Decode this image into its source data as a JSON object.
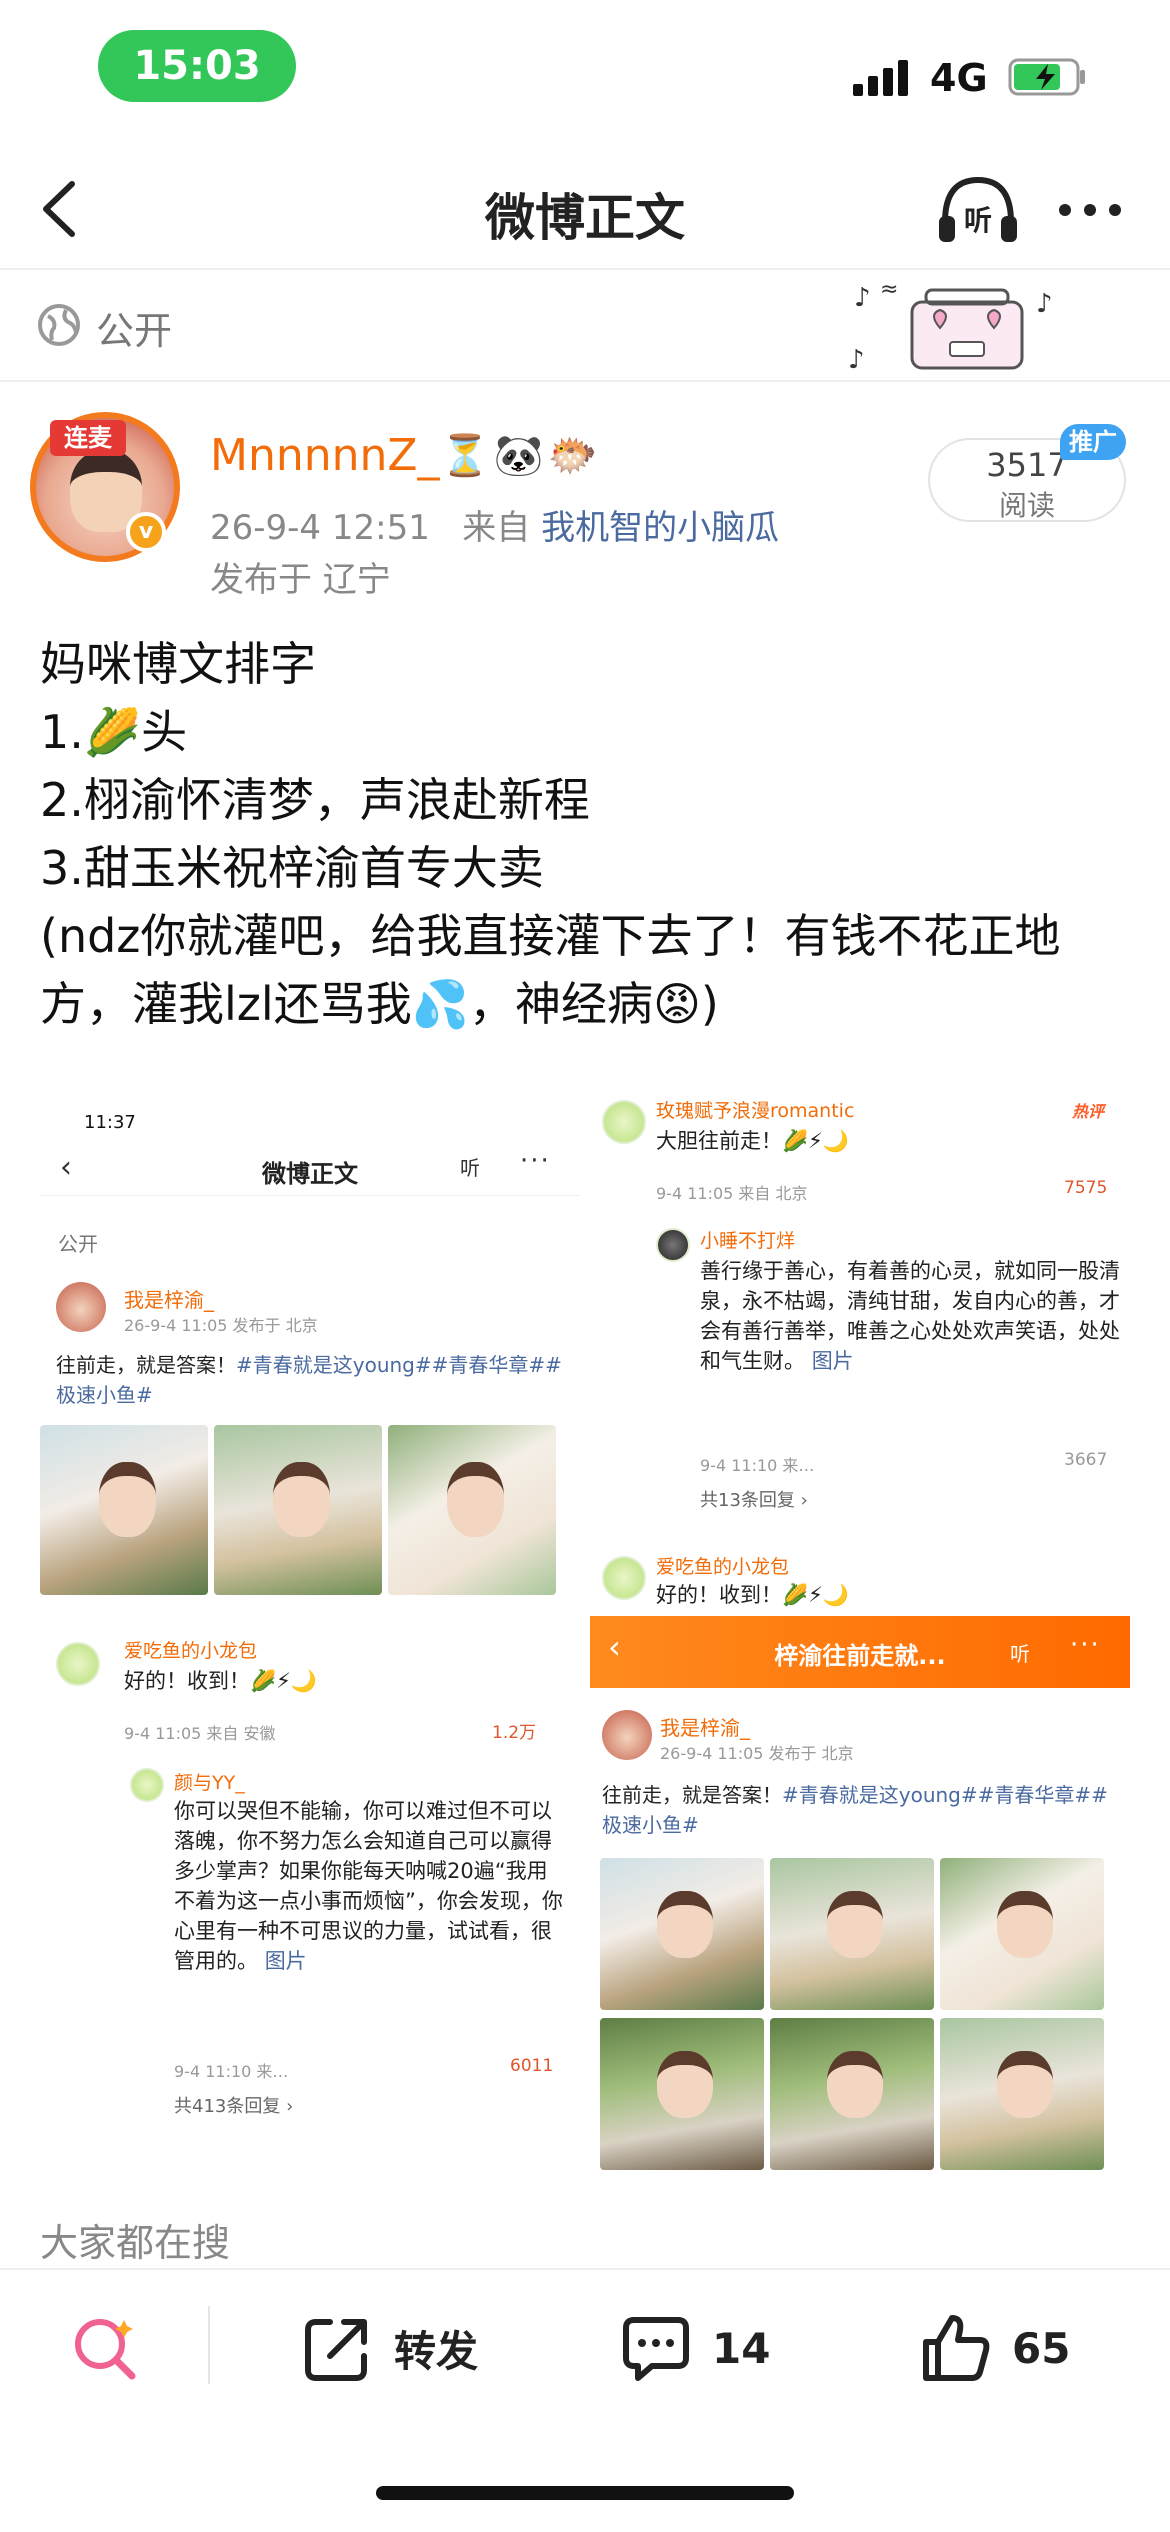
{
  "status_bar": {
    "time": "15:03",
    "network": "4G"
  },
  "nav": {
    "title": "微博正文",
    "listen_label": "听"
  },
  "visibility": {
    "label": "公开"
  },
  "author": {
    "avatar_tag": "连麦",
    "name": "MnnnnnZ_",
    "name_emojis": [
      "⏳",
      "🐼",
      "🐡"
    ],
    "timestamp": "26-9-4 12:51",
    "source_prefix": "来自",
    "source": "我机智的小脑瓜",
    "location": "发布于 辽宁"
  },
  "read_counter": {
    "count": "3517",
    "label": "阅读",
    "promo": "推广"
  },
  "post_lines": [
    "妈咪博文排字",
    "1.🌽头",
    "2.栩渝怀清梦，声浪赴新程",
    "3.甜玉米祝梓渝首专大卖",
    "(ndz你就灌吧，给我直接灌下去了！有钱不花正地方，灌我lzl还骂我💦，神经病😡)"
  ],
  "embedded": {
    "left": {
      "status_time": "11:37",
      "nav_title": "微博正文",
      "nav_listen": "听",
      "visibility": "公开",
      "post_author": "我是梓渝_",
      "post_meta": "26-9-4 11:05  发布于 北京",
      "post_text": "往前走，就是答案！",
      "post_tags": "#青春就是这young##青春华章##极速小鱼#",
      "comment1": {
        "name": "爱吃鱼的小龙包",
        "text": "好的！收到！🌽⚡🌙",
        "meta": "9-4 11:05 来自 安徽",
        "likes": "1.2万"
      },
      "reply1": {
        "name": "颜与YY_",
        "text": "你可以哭但不能输，你可以难过但不可以落魄，你不努力怎么会知道自己可以赢得多少掌声？如果你能每天呐喊20遍“我用不着为这一点小事而烦恼”，你会发现，你心里有一种不可思议的力量，试试看，很管用的。",
        "image_link": "图片",
        "meta": "9-4 11:10 来…",
        "likes": "6011"
      },
      "more_replies": "共413条回复 ›"
    },
    "right": {
      "comment1": {
        "name": "玫瑰赋予浪漫romantic",
        "hot": "热评",
        "text": "大胆往前走！🌽⚡🌙",
        "meta": "9-4 11:05 来自 北京",
        "likes": "7575"
      },
      "reply1": {
        "name": "小睡不打烊",
        "text": "善行缘于善心，有着善的心灵，就如同一股清泉，永不枯竭，清纯甘甜，发自内心的善，才会有善行善举，唯善之心处处欢声笑语，处处和气生财。",
        "image_link": "图片",
        "meta": "9-4 11:10 来…",
        "likes": "3667"
      },
      "more_replies": "共13条回复 ›",
      "comment2": {
        "name": "爱吃鱼的小龙包",
        "text": "好的！收到！🌽⚡🌙"
      },
      "orange_title": "梓渝往前走就...",
      "orange_listen": "听",
      "post_author": "我是梓渝_",
      "post_meta": "26-9-4 11:05  发布于 北京",
      "post_text": "往前走，就是答案！",
      "post_tags": "#青春就是这young##青春华章##极速小鱼#"
    }
  },
  "section_label": "大家都在搜",
  "toolbar": {
    "repost_label": "转发",
    "comments_count": "14",
    "likes_count": "65"
  },
  "colors": {
    "status_pill": "#33c759",
    "accent_orange": "#f26d0a",
    "link_blue": "#4a6aa0",
    "promo_blue": "#3fa3f4"
  }
}
